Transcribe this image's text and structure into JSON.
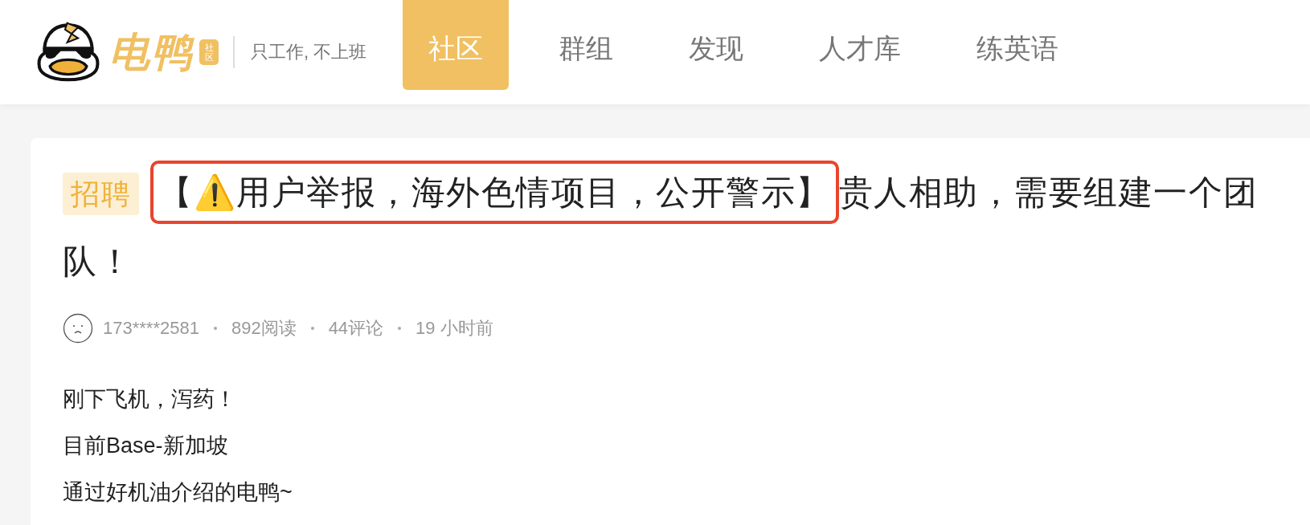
{
  "header": {
    "brand": "电鸭",
    "brand_badge": "社区",
    "slogan": "只工作, 不上班",
    "tabs": [
      {
        "label": "社区",
        "selected": true
      },
      {
        "label": "群组",
        "selected": false
      },
      {
        "label": "发现",
        "selected": false
      },
      {
        "label": "人才库",
        "selected": false
      },
      {
        "label": "练英语",
        "selected": false
      }
    ]
  },
  "post": {
    "tag": "招聘",
    "title_parts": [
      {
        "text": "【⚠️用户举报，海外色情项目，公开警示】",
        "highlighted": true
      },
      {
        "text": "贵人相助，需要组建一个团队！",
        "highlighted": false
      }
    ],
    "author": "173****2581",
    "reads": "892阅读",
    "comments": "44评论",
    "time": "19 小时前",
    "body": [
      "刚下飞机，泻药！",
      "目前Base-新加坡",
      "通过好机油介绍的电鸭~"
    ]
  }
}
